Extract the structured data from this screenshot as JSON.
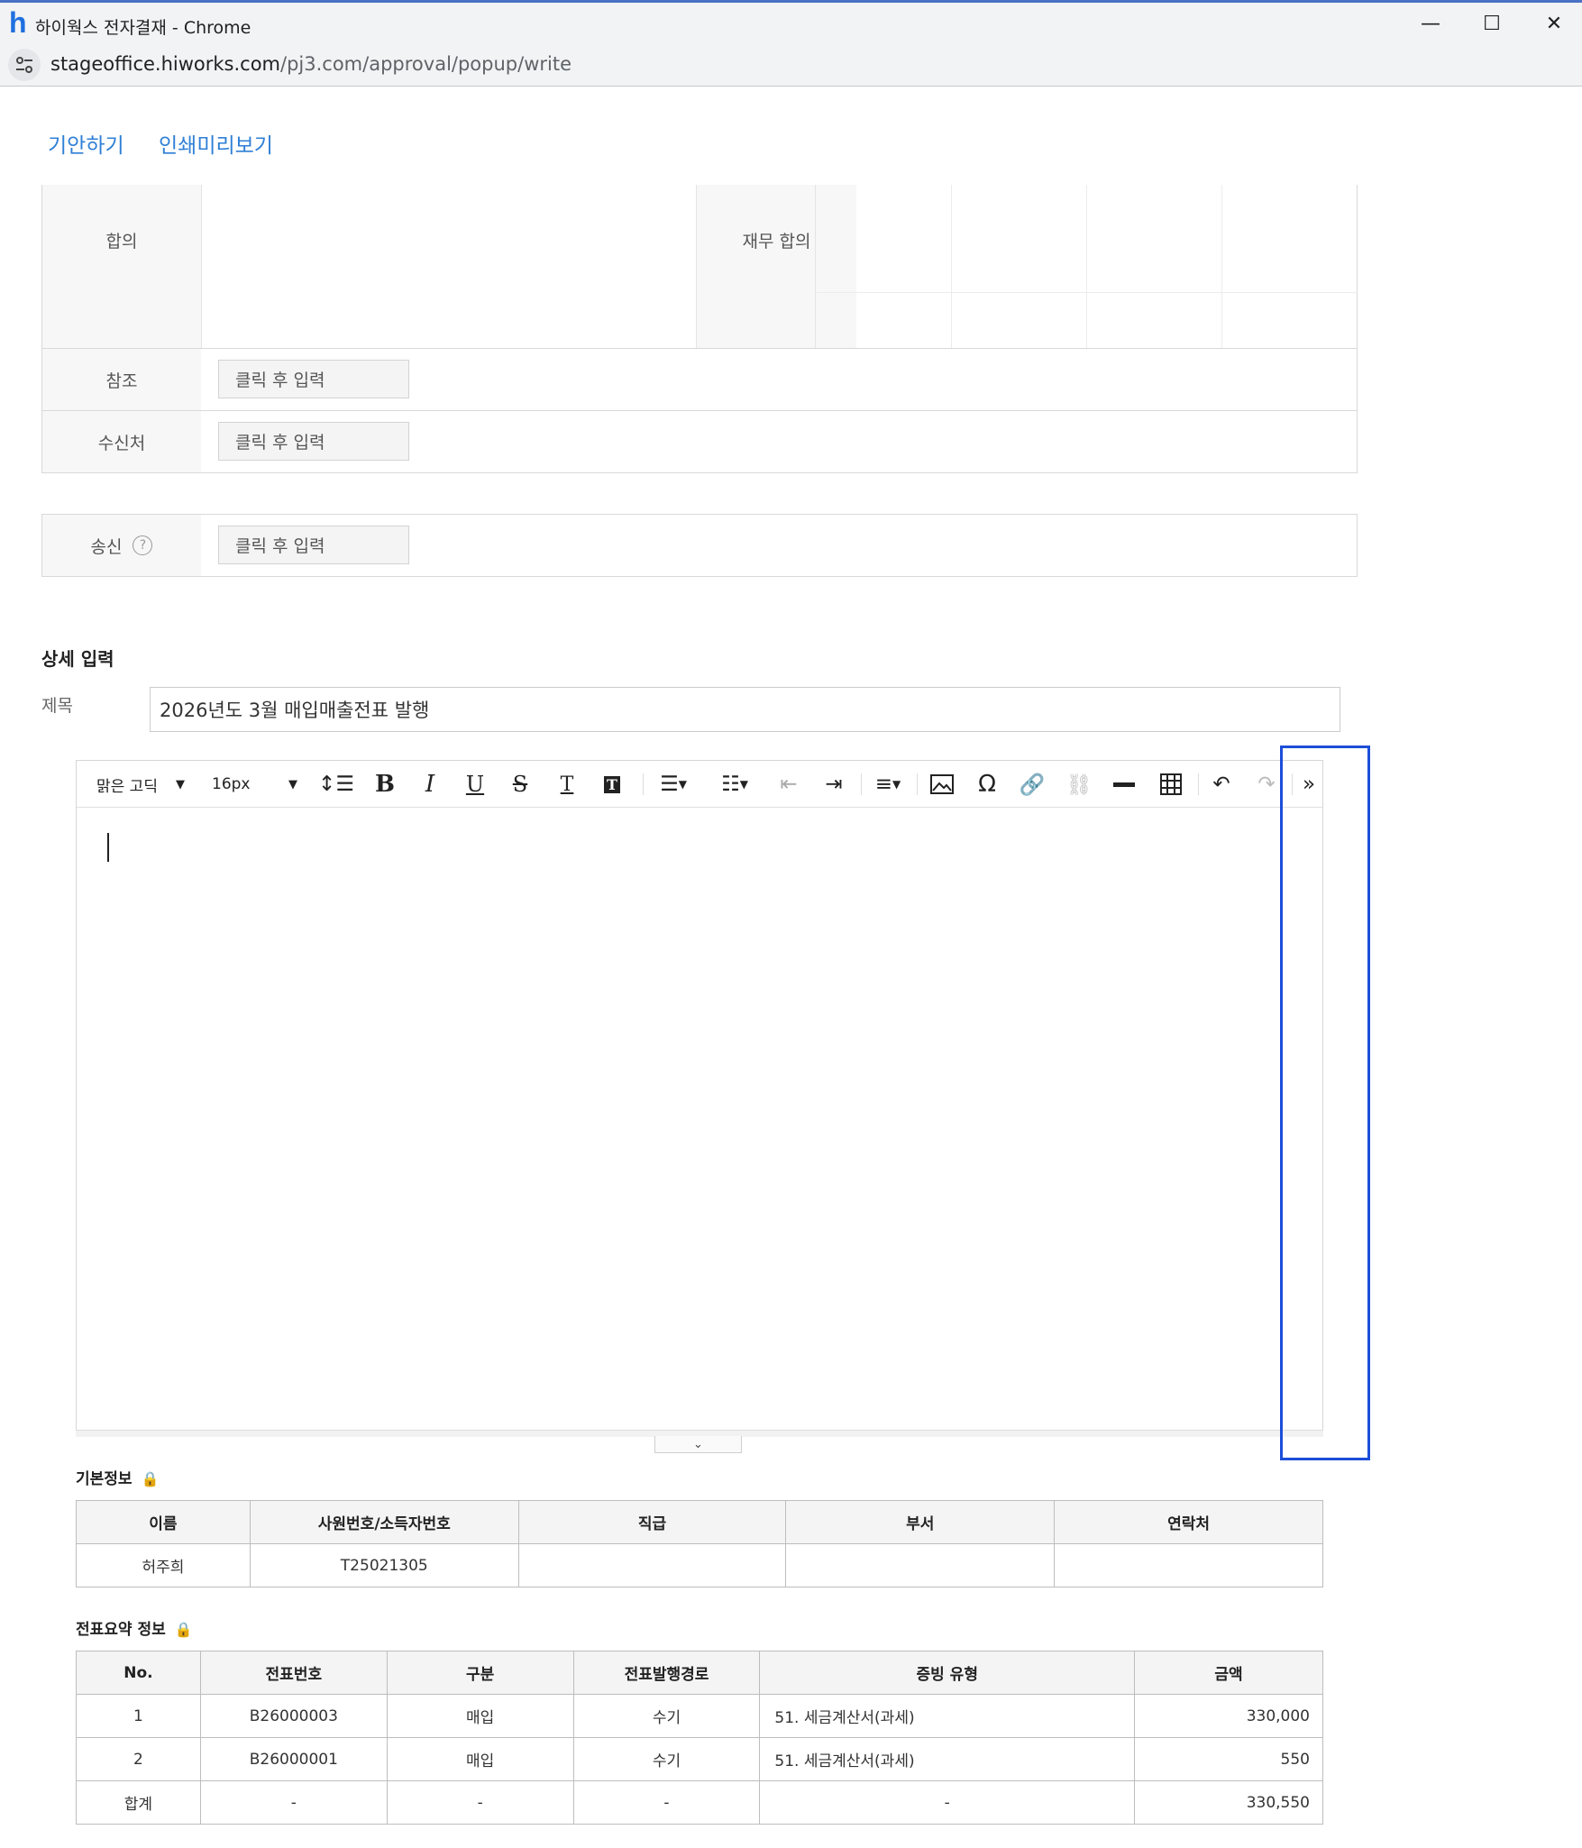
{
  "window": {
    "logo": "h",
    "title": "하이웍스 전자결재 - Chrome",
    "minimize": "—",
    "maximize": "☐",
    "close": "✕"
  },
  "address": {
    "host": "stageoffice.hiworks.com",
    "path": "/pj3.com/approval/popup/write"
  },
  "actions": {
    "draft": "기안하기",
    "print_preview": "인쇄미리보기"
  },
  "approval": {
    "agreement_label": "합의",
    "finance_agreement_label": "재무 합의"
  },
  "recipients": {
    "reference_label": "참조",
    "receiver_label": "수신처",
    "send_label": "송신",
    "click_input": "클릭 후 입력",
    "help": "?"
  },
  "detail": {
    "section_title": "상세 입력",
    "subject_label": "제목",
    "subject_value": "2026년도 3월 매입매출전표 발행"
  },
  "editor": {
    "font_family": "맑은 고딕",
    "font_size": "16px",
    "more": "»",
    "expand": "⌄"
  },
  "basic_info": {
    "title": "기본정보",
    "headers": [
      "이름",
      "사원번호/소득자번호",
      "직급",
      "부서",
      "연락처"
    ],
    "rows": [
      [
        "허주희",
        "T25021305",
        "",
        "",
        ""
      ]
    ]
  },
  "voucher_summary": {
    "title": "전표요약 정보",
    "headers": [
      "No.",
      "전표번호",
      "구분",
      "전표발행경로",
      "증빙 유형",
      "금액"
    ],
    "rows": [
      [
        "1",
        "B26000003",
        "매입",
        "수기",
        "51. 세금계산서(과세)",
        "330,000"
      ],
      [
        "2",
        "B26000001",
        "매입",
        "수기",
        "51. 세금계산서(과세)",
        "550"
      ],
      [
        "합계",
        "-",
        "-",
        "-",
        "-",
        "330,550"
      ]
    ]
  }
}
